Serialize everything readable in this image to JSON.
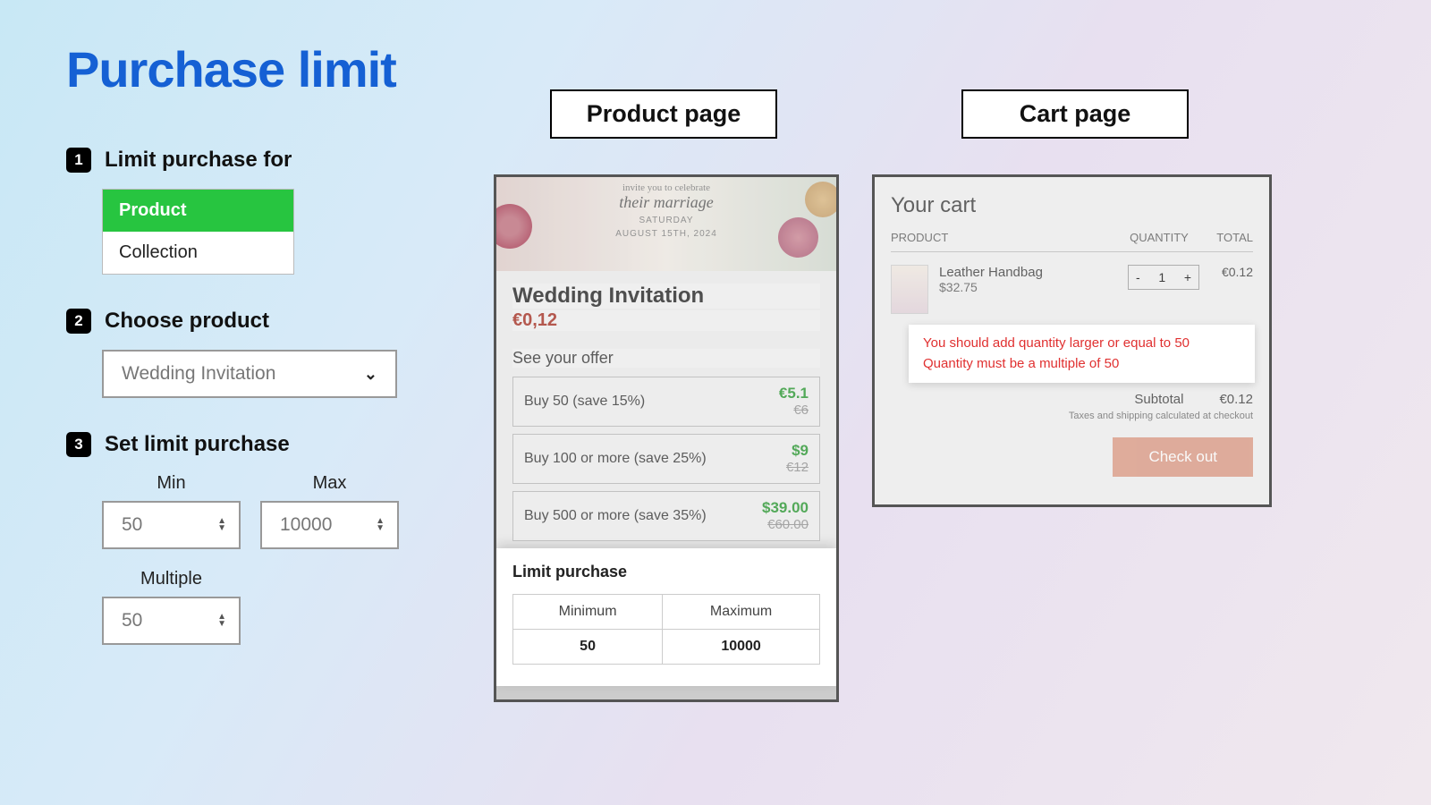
{
  "title": "Purchase limit",
  "steps": {
    "s1": {
      "num": "1",
      "label": "Limit purchase for",
      "optProduct": "Product",
      "optCollection": "Collection"
    },
    "s2": {
      "num": "2",
      "label": "Choose product",
      "selected": "Wedding Invitation"
    },
    "s3": {
      "num": "3",
      "label": "Set limit purchase",
      "minLabel": "Min",
      "minVal": "50",
      "maxLabel": "Max",
      "maxVal": "10000",
      "multLabel": "Multiple",
      "multVal": "50"
    }
  },
  "panes": {
    "product": "Product page",
    "cart": "Cart page"
  },
  "productMock": {
    "inviteL1": "invite you to celebrate",
    "inviteL2": "their marriage",
    "inviteL3": "SATURDAY",
    "inviteL4": "AUGUST 15TH, 2024",
    "title": "Wedding Invitation",
    "price": "€0,12",
    "offerHead": "See your offer",
    "offers": [
      {
        "label": "Buy 50 (save 15%)",
        "new": "€5.1",
        "old": "€6"
      },
      {
        "label": "Buy 100 or more (save 25%)",
        "new": "$9",
        "old": "€12"
      },
      {
        "label": "Buy 500 or more (save 35%)",
        "new": "$39.00",
        "old": "€60.00"
      }
    ],
    "limitTitle": "Limit purchase",
    "colMin": "Minimum",
    "colMax": "Maximum",
    "valMin": "50",
    "valMax": "10000"
  },
  "cartMock": {
    "title": "Your cart",
    "hProd": "PRODUCT",
    "hQty": "QUANTITY",
    "hTot": "TOTAL",
    "itemName": "Leather Handbag",
    "itemPrice": "$32.75",
    "qtyMinus": "-",
    "qtyVal": "1",
    "qtyPlus": "+",
    "lineTotal": "€0.12",
    "err1": "You should add quantity larger or equal to 50",
    "err2": "Quantity must be a multiple of 50",
    "subLabel": "Subtotal",
    "subVal": "€0.12",
    "taxNote": "Taxes and shipping calculated at checkout",
    "checkout": "Check out"
  }
}
